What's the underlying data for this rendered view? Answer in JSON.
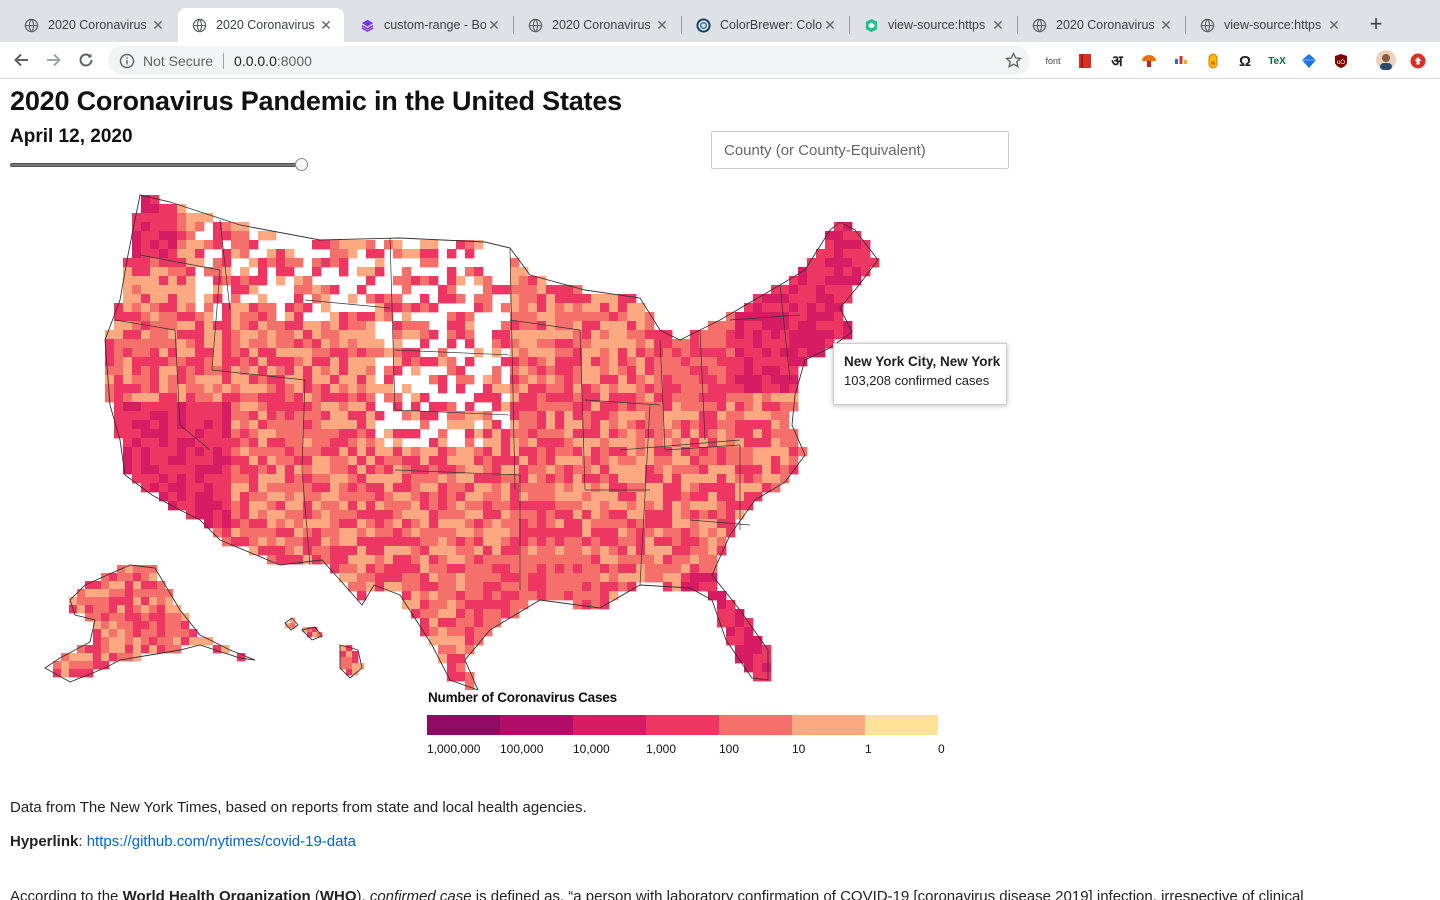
{
  "browser": {
    "tabs": [
      {
        "title": "2020 Coronavirus",
        "icon": "globe-icon",
        "active": false
      },
      {
        "title": "2020 Coronavirus",
        "icon": "globe-icon",
        "active": true
      },
      {
        "title": "custom-range - Bo",
        "icon": "bootstrap-icon",
        "active": false
      },
      {
        "title": "2020 Coronavirus",
        "icon": "globe-icon",
        "active": false
      },
      {
        "title": "ColorBrewer: Colo",
        "icon": "colorbrewer-icon",
        "active": false
      },
      {
        "title": "view-source:https",
        "icon": "shield-icon",
        "active": false
      },
      {
        "title": "2020 Coronavirus",
        "icon": "globe-icon",
        "active": false
      },
      {
        "title": "view-source:https",
        "icon": "globe-icon",
        "active": false
      }
    ],
    "security_label": "Not Secure",
    "url_host": "0.0.0.0",
    "url_port": ":8000",
    "extensions": [
      "font",
      "red-book-icon",
      "अ",
      "mushroom-icon",
      "bars-icon",
      "pill-icon",
      "Ω",
      "TeX",
      "diamond-icon",
      "ublock-icon",
      "avatar",
      "upload-icon"
    ]
  },
  "page": {
    "title": "2020 Coronavirus Pandemic in the United States",
    "date_label": "April 12, 2020",
    "slider_level": 1.0,
    "search_placeholder": "County (or County-Equivalent)",
    "tooltip": {
      "name": "New York City, New York",
      "cases": "103,208 confirmed cases"
    },
    "legend": {
      "title": "Number of Coronavirus Cases",
      "colors": [
        "#8f0a63",
        "#b00d6a",
        "#d61c62",
        "#ee3662",
        "#f6706b",
        "#fca880",
        "#fde297"
      ],
      "labels": [
        "1,000,000",
        "100,000",
        "10,000",
        "1,000",
        "100",
        "10",
        "1",
        "0"
      ]
    },
    "source_text": "Data from The New York Times, based on reports from state and local health agencies.",
    "hyperlink_label": "Hyperlink",
    "hyperlink_sep": ": ",
    "hyperlink_url": "https://github.com/nytimes/covid-19-data",
    "who_intro": "According to the ",
    "who_name": "World Health Organization",
    "who_paren_open": " (",
    "who_abbr": "WHO",
    "who_paren_close": "), ",
    "who_term": "confirmed case",
    "who_rest": " is defined as, “a person with laboratory confirmation of COVID-19 [coronavirus disease 2019] infection, irrespective of clinical"
  }
}
